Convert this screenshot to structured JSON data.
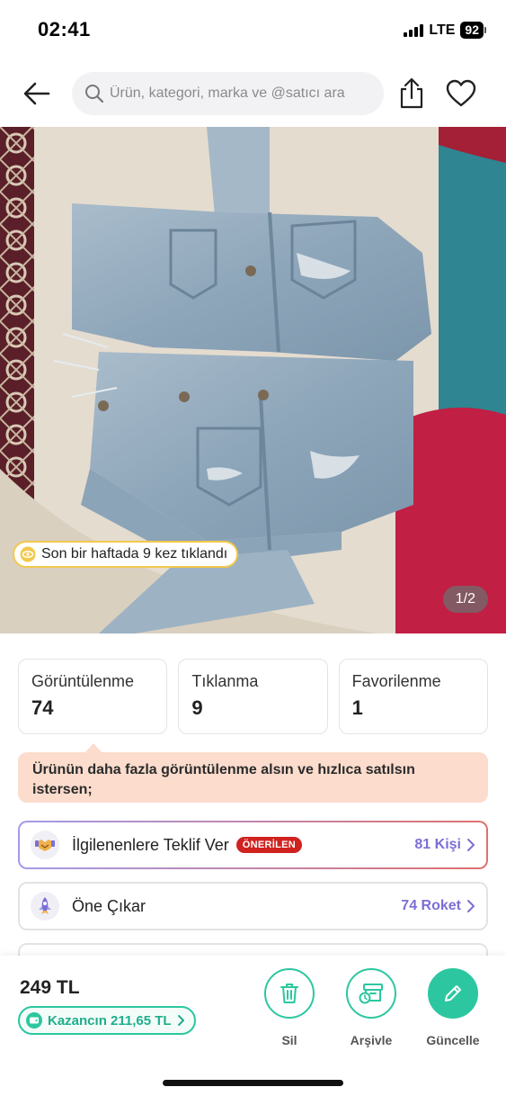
{
  "status_bar": {
    "time": "02:41",
    "network": "LTE",
    "battery": "92"
  },
  "header": {
    "back_icon": "arrow-left-icon",
    "search_placeholder": "Ürün, kategori, marka ve @satıcı ara",
    "share_icon": "share-icon",
    "favorite_icon": "heart-icon"
  },
  "photo": {
    "click_badge": "Son bir haftada 9 kez tıklandı",
    "page_indicator": "1/2"
  },
  "stats": [
    {
      "label": "Görüntülenme",
      "value": "74"
    },
    {
      "label": "Tıklanma",
      "value": "9"
    },
    {
      "label": "Favorilenme",
      "value": "1"
    }
  ],
  "tip": {
    "text": "Ürünün daha fazla görüntülenme alsın ve hızlıca satılsın istersen;"
  },
  "actions": {
    "offer": {
      "label": "İlgilenenlere Teklif Ver",
      "badge": "ÖNERİLEN",
      "count": "81 Kişi"
    },
    "boost": {
      "label": "Öne Çıkar",
      "count": "74 Roket"
    }
  },
  "bottom_bar": {
    "price": "249 TL",
    "earnings": "Kazancın 211,65 TL",
    "buttons": [
      {
        "label": "Sil",
        "icon": "trash-icon"
      },
      {
        "label": "Arşivle",
        "icon": "archive-icon"
      },
      {
        "label": "Güncelle",
        "icon": "pencil-icon"
      }
    ]
  },
  "colors": {
    "accent_green": "#2cc7a0",
    "accent_purple": "#7b6fd6",
    "badge_red": "#d0221f",
    "tip_background": "#fbdccd"
  }
}
